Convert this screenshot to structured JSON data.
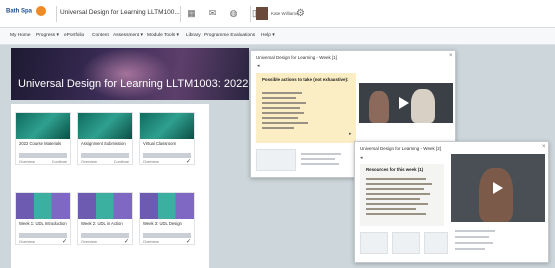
{
  "header": {
    "logo_text": "Bath Spa",
    "course_title": "Universal Design for Learning LLTM100...",
    "user_name": "Kate Williams",
    "icons": [
      "grid-icon",
      "mail-icon",
      "chat-icon",
      "bell-icon",
      "gear-icon"
    ]
  },
  "nav": {
    "items": [
      "My Home",
      "Progress ▾",
      "ePortfolio",
      "Content",
      "Assessment ▾",
      "Module Tools ▾",
      "Library",
      "Programme Evaluations",
      "Help ▾"
    ]
  },
  "banner": {
    "title": "Universal Design for Learning LLTM1003: 2022-23"
  },
  "cards": [
    {
      "title": "2022 Course Materials",
      "thumb": "teal",
      "status_left": "Overview",
      "status_right": "Continue",
      "checked": false
    },
    {
      "title": "Assignment Submission",
      "thumb": "teal",
      "status_left": "Overview",
      "status_right": "Continue",
      "checked": false
    },
    {
      "title": "Virtual Classroom",
      "thumb": "teal",
      "status_left": "Overview",
      "status_right": "",
      "checked": true
    },
    {
      "title": "Week 1: UDL Introduction",
      "thumb": "strip",
      "status_left": "Overview",
      "status_right": "",
      "checked": true
    },
    {
      "title": "Week 2: UDL in Action",
      "thumb": "strip",
      "status_left": "Overview",
      "status_right": "",
      "checked": true
    },
    {
      "title": "Week 3: UDL Design",
      "thumb": "strip",
      "status_left": "Overview",
      "status_right": "",
      "checked": true
    }
  ],
  "popup1": {
    "title": "Universal Design for Learning - Week [1]",
    "note_heading": "Possible actions to take (not exhaustive):"
  },
  "popup2": {
    "title": "Universal Design for Learning - Week [2]",
    "note_heading": "Resources for this week (1)"
  },
  "colors": {
    "banner_start": "#1e1a33",
    "banner_end": "#5d3f6b",
    "card_teal": "#1f8a7a",
    "card_purple": "#6c5bb0",
    "note_yellow": "#fbeec4",
    "accent_orange": "#f08a24"
  }
}
